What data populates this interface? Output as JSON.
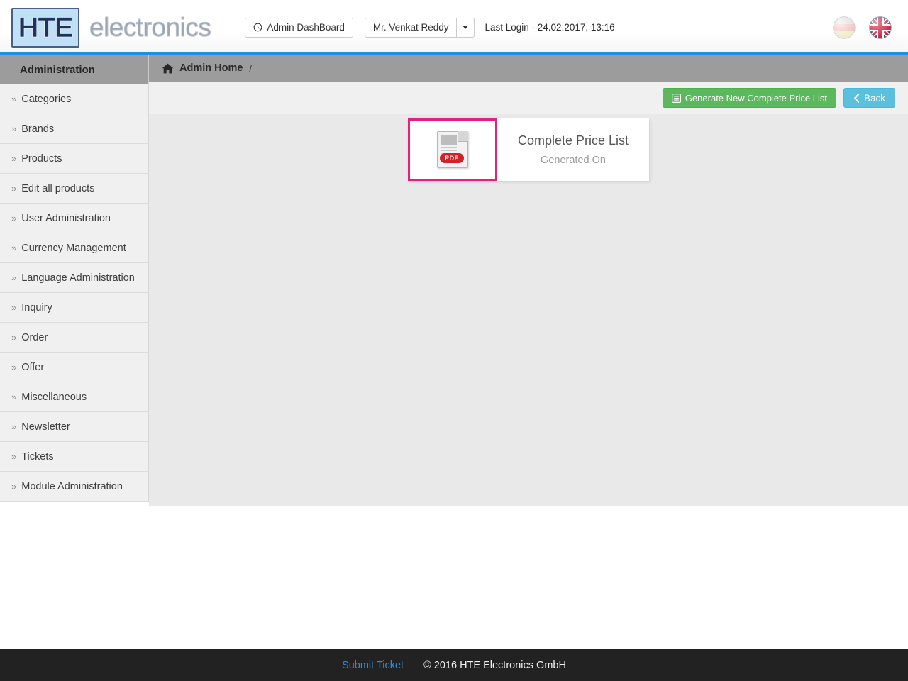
{
  "header": {
    "logo_letters": "HTE",
    "logo_word": "electronics",
    "dashboard_label": "Admin DashBoard",
    "user_label": "Mr. Venkat Reddy",
    "last_login": "Last Login - 24.02.2017, 13:16",
    "clock_icon": "clock-icon",
    "caret_icon": "chevron-down-icon",
    "flag_de": "german-flag-icon",
    "flag_en": "uk-flag-icon",
    "accent_color": "#1b90e8"
  },
  "sidebar": {
    "title": "Administration",
    "bullet": "»",
    "items": [
      {
        "label": "Categories"
      },
      {
        "label": "Brands"
      },
      {
        "label": "Products"
      },
      {
        "label": "Edit all products"
      },
      {
        "label": "User Administration"
      },
      {
        "label": "Currency Management"
      },
      {
        "label": "Language Administration"
      },
      {
        "label": "Inquiry"
      },
      {
        "label": "Order"
      },
      {
        "label": "Offer"
      },
      {
        "label": "Miscellaneous"
      },
      {
        "label": "Newsletter"
      },
      {
        "label": "Tickets"
      },
      {
        "label": "Module Administration"
      }
    ]
  },
  "breadcrumb": {
    "home_icon": "home-icon",
    "label": "Admin Home",
    "separator": "/"
  },
  "toolbar": {
    "generate_label": "Generate New Complete Price List",
    "generate_icon": "list-icon",
    "generate_color": "#5cb85c",
    "back_label": "Back",
    "back_icon": "chevron-left-icon",
    "back_color": "#5bc0de"
  },
  "card": {
    "file_icon": "pdf-file-icon",
    "badge": "PDF",
    "title": "Complete Price List",
    "subtitle": "Generated On",
    "highlight_color": "#e5207e"
  },
  "footer": {
    "link_label": "Submit Ticket",
    "copyright": "© 2016 HTE Electronics GmbH"
  }
}
